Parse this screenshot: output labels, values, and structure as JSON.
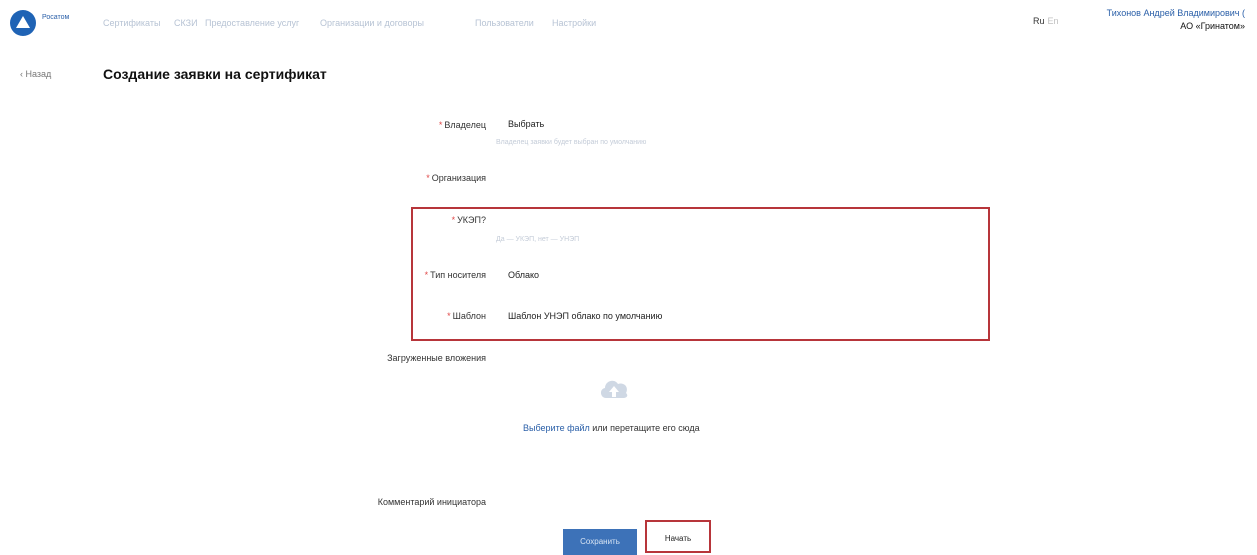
{
  "header": {
    "logo_text": "Росатом",
    "nav": [
      "Сертификаты",
      "СКЗИ",
      "Предоставление услуг",
      "Организации и договоры",
      "Пользователи",
      "Настройки"
    ],
    "lang_ru": "Ru",
    "lang_en": "En",
    "user_name": "Тихонов Андрей Владимирович (",
    "user_org": "АО «Гринатом»"
  },
  "page": {
    "back": "‹ Назад",
    "title": "Создание заявки на сертификат"
  },
  "form": {
    "owner_label": "Владелец",
    "owner_value": "Выбрать",
    "owner_hint": "Владелец заявки будет выбран по умолчанию",
    "org_label": "Организация",
    "ukep_label": "УКЭП?",
    "ukep_hint": "Да — УКЭП, нет — УНЭП",
    "media_label": "Тип носителя",
    "media_value": "Облако",
    "template_label": "Шаблон",
    "template_value": "Шаблон УНЭП облако по умолчанию",
    "attachments_label": "Загруженные вложения",
    "upload_link": "Выберите файл",
    "upload_rest": " или перетащите его сюда",
    "comment_label": "Комментарий инициатора",
    "req": "*"
  },
  "buttons": {
    "save": "Сохранить",
    "start": "Начать"
  },
  "colors": {
    "accent": "#3d72b8",
    "highlight": "#b7353a",
    "required": "#e04848"
  }
}
